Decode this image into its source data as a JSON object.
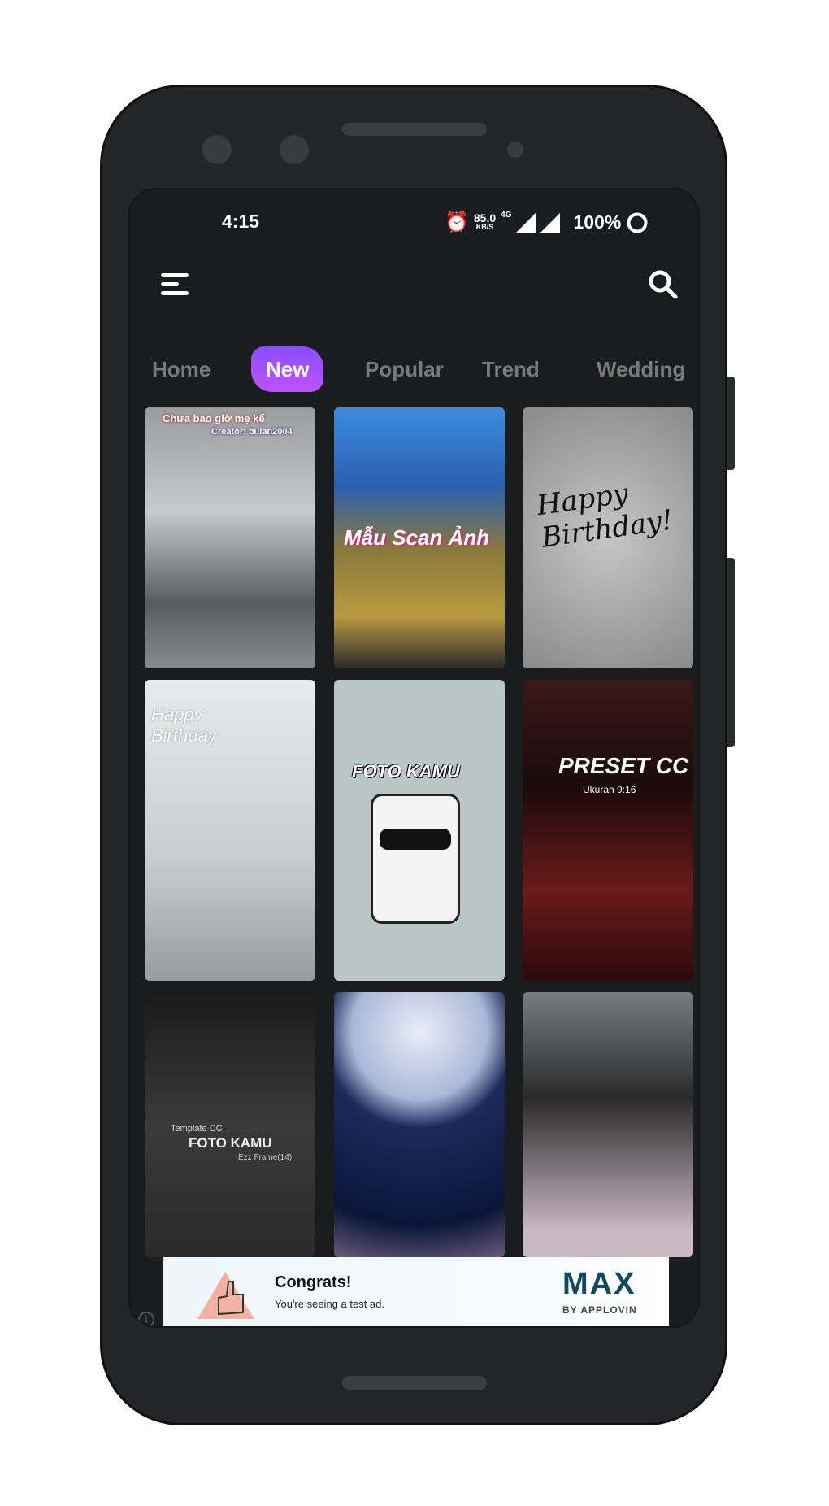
{
  "status_bar": {
    "time": "4:15",
    "net_speed": "85.0",
    "net_unit": "KB/S",
    "network": "4G",
    "battery": "100%"
  },
  "header": {
    "menu_icon": "hamburger-menu-icon",
    "search_icon": "search-icon"
  },
  "tabs": [
    {
      "label": "Home"
    },
    {
      "label": "New",
      "active": true
    },
    {
      "label": "Popular"
    },
    {
      "label": "Trend"
    },
    {
      "label": "Wedding"
    }
  ],
  "accent": "#a44fff",
  "grid": [
    {
      "t1": "Chưa bao giờ mẹ kể",
      "t2": "Creator: buian2004"
    },
    {
      "t1": "Mẫu Scan Ảnh"
    },
    {
      "t1": "Happy Birthday!"
    },
    {
      "t1": "Happy Birthday"
    },
    {
      "t1": "FOTO KAMU"
    },
    {
      "t1": "PRESET CC",
      "t2": "Ukuran 9:16"
    },
    {
      "t1": "FOTO KAMU",
      "t2": "Template CC",
      "t3": "Ezz Frame(14)"
    },
    {},
    {}
  ],
  "ad": {
    "title": "Congrats!",
    "subtitle": "You're seeing a test ad.",
    "brand": "MAX",
    "brand_sub": "BY APPLOVIN",
    "info_icon": "info-icon"
  }
}
